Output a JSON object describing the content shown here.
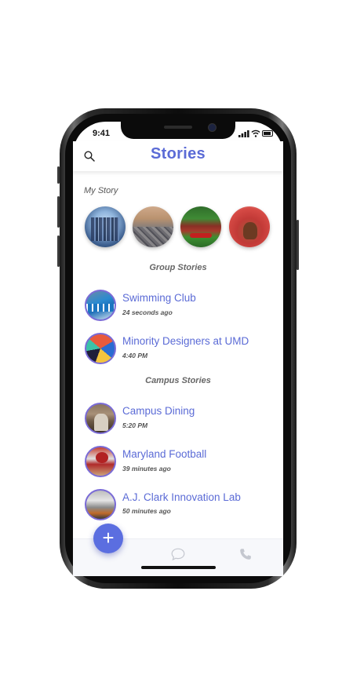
{
  "status_bar": {
    "time": "9:41"
  },
  "header": {
    "title": "Stories",
    "search_icon": "search-icon"
  },
  "my_story": {
    "label": "My Story",
    "circles": [
      "city-skyline-image",
      "city-aerial-image",
      "campus-building-image",
      "crowd-mascot-image"
    ]
  },
  "group_stories": {
    "label": "Group Stories",
    "items": [
      {
        "name": "Swimming Club",
        "time": "24 seconds ago"
      },
      {
        "name": "Minority Designers at UMD",
        "time": "4:40 PM"
      }
    ]
  },
  "campus_stories": {
    "label": "Campus Stories",
    "items": [
      {
        "name": "Campus Dining",
        "time": "5:20 PM"
      },
      {
        "name": "Maryland Football",
        "time": "39 minutes ago"
      },
      {
        "name": "A.J. Clark Innovation Lab",
        "time": "50 minutes ago"
      }
    ]
  },
  "bottom_bar": {
    "fab_label": "+",
    "icons": [
      "chat-icon",
      "phone-icon"
    ]
  },
  "colors": {
    "accent": "#5b6bd6",
    "fab": "#5b6ee0",
    "text_muted": "#555555"
  }
}
